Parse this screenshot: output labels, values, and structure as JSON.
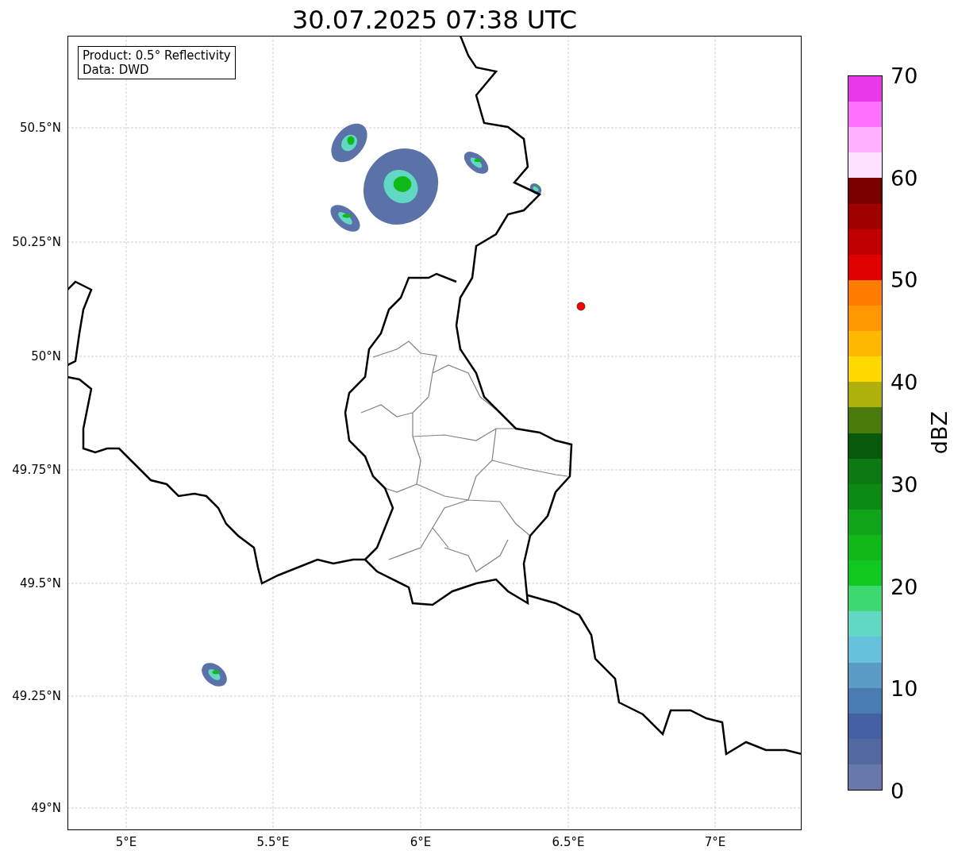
{
  "title": "30.07.2025 07:38 UTC",
  "info_box": {
    "lines": [
      "Product: 0.5° Reflectivity",
      "Data: DWD"
    ]
  },
  "lat_ticks": [
    "50.5°N",
    "50.25°N",
    "50°N",
    "49.75°N",
    "49.5°N",
    "49.25°N",
    "49°N"
  ],
  "lon_ticks": [
    "5°E",
    "5.5°E",
    "6°E",
    "6.5°E",
    "7°E"
  ],
  "colorbar": {
    "label": "dBZ",
    "ticks": [
      "70",
      "60",
      "50",
      "40",
      "30",
      "20",
      "10",
      "0"
    ],
    "bands": [
      {
        "color": "#e838e8"
      },
      {
        "color": "#ff70ff"
      },
      {
        "color": "#ffb0ff"
      },
      {
        "color": "#ffe0ff"
      },
      {
        "color": "#780000"
      },
      {
        "color": "#a00000"
      },
      {
        "color": "#c00000"
      },
      {
        "color": "#e00000"
      },
      {
        "color": "#ff7c00"
      },
      {
        "color": "#ff9800"
      },
      {
        "color": "#ffb800"
      },
      {
        "color": "#ffd800"
      },
      {
        "color": "#b0b00a"
      },
      {
        "color": "#4a7a0a"
      },
      {
        "color": "#075a0a"
      },
      {
        "color": "#0b7a13"
      },
      {
        "color": "#0c8a14"
      },
      {
        "color": "#10a418"
      },
      {
        "color": "#10b818"
      },
      {
        "color": "#10c820"
      },
      {
        "color": "#3ed870"
      },
      {
        "color": "#60d8c4"
      },
      {
        "color": "#66c2dc"
      },
      {
        "color": "#5a9cc6"
      },
      {
        "color": "#4a7cb4"
      },
      {
        "color": "#4560a2"
      },
      {
        "color": "#5468a0"
      },
      {
        "color": "#6878a8"
      }
    ]
  }
}
